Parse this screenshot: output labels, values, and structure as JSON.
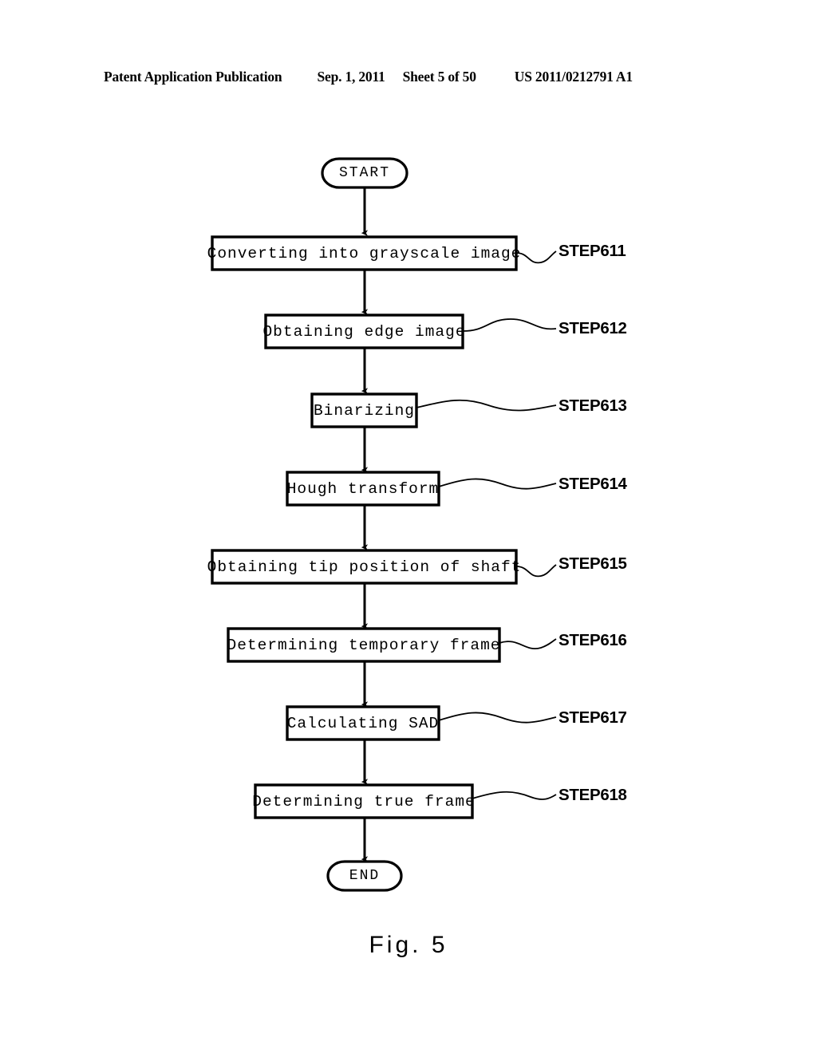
{
  "header": {
    "publication": "Patent Application Publication",
    "date": "Sep. 1, 2011",
    "sheet": "Sheet 5 of 50",
    "patent_number": "US 2011/0212791 A1"
  },
  "figure": {
    "caption": "Fig. 5",
    "start_label": "START",
    "end_label": "END",
    "steps": [
      {
        "text": "Converting into grayscale image",
        "ref": "STEP611"
      },
      {
        "text": "Obtaining edge image",
        "ref": "STEP612"
      },
      {
        "text": "Binarizing",
        "ref": "STEP613"
      },
      {
        "text": "Hough transform",
        "ref": "STEP614"
      },
      {
        "text": "Obtaining tip position of shaft",
        "ref": "STEP615"
      },
      {
        "text": "Determining temporary frame",
        "ref": "STEP616"
      },
      {
        "text": "Calculating SAD",
        "ref": "STEP617"
      },
      {
        "text": "Determining true frame",
        "ref": "STEP618"
      }
    ]
  },
  "colors": {
    "ink": "#000000",
    "paper": "#ffffff"
  }
}
